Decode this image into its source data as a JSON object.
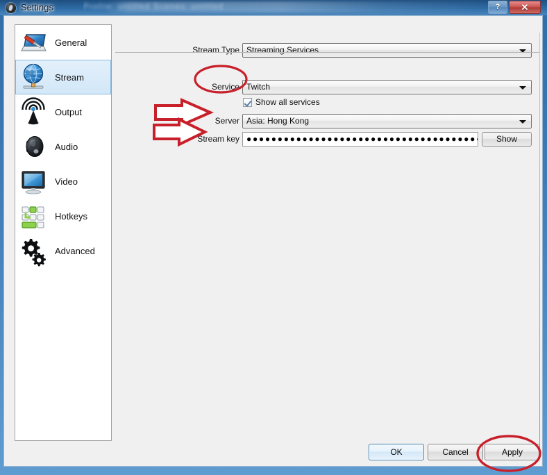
{
  "window": {
    "title": "Settings",
    "app_icon": "obs-icon",
    "help_button": "?",
    "close_button": "✕",
    "background_bleed_text": "Profile: untitled    Scenes: untitled"
  },
  "sidebar": {
    "items": [
      {
        "label": "General",
        "icon": "general-monitor-screwdriver-icon",
        "selected": false
      },
      {
        "label": "Stream",
        "icon": "globe-network-icon",
        "selected": true
      },
      {
        "label": "Output",
        "icon": "broadcast-antenna-icon",
        "selected": false
      },
      {
        "label": "Audio",
        "icon": "speaker-icon",
        "selected": false
      },
      {
        "label": "Video",
        "icon": "monitor-icon",
        "selected": false
      },
      {
        "label": "Hotkeys",
        "icon": "keyboard-keys-icon",
        "selected": false
      },
      {
        "label": "Advanced",
        "icon": "gears-icon",
        "selected": false
      }
    ]
  },
  "form": {
    "stream_type": {
      "label": "Stream Type",
      "value": "Streaming Services"
    },
    "service": {
      "label": "Service",
      "value": "Twitch"
    },
    "show_all_services": {
      "label": "Show all services",
      "checked": true
    },
    "server": {
      "label": "Server",
      "value": "Asia: Hong Kong"
    },
    "stream_key": {
      "label": "Stream key",
      "value": "●●●●●●●●●●●●●●●●●●●●●●●●●●●●●●●●●●●●●●●●●●●",
      "show_button": "Show"
    }
  },
  "buttons": {
    "ok": "OK",
    "cancel": "Cancel",
    "apply": "Apply"
  },
  "annotations": {
    "accent_color": "#c8202a",
    "items": [
      {
        "type": "ellipse",
        "target": "service-label"
      },
      {
        "type": "arrow",
        "target": "server-label"
      },
      {
        "type": "arrow",
        "target": "stream-key-label"
      },
      {
        "type": "ellipse",
        "target": "apply-button"
      }
    ]
  }
}
